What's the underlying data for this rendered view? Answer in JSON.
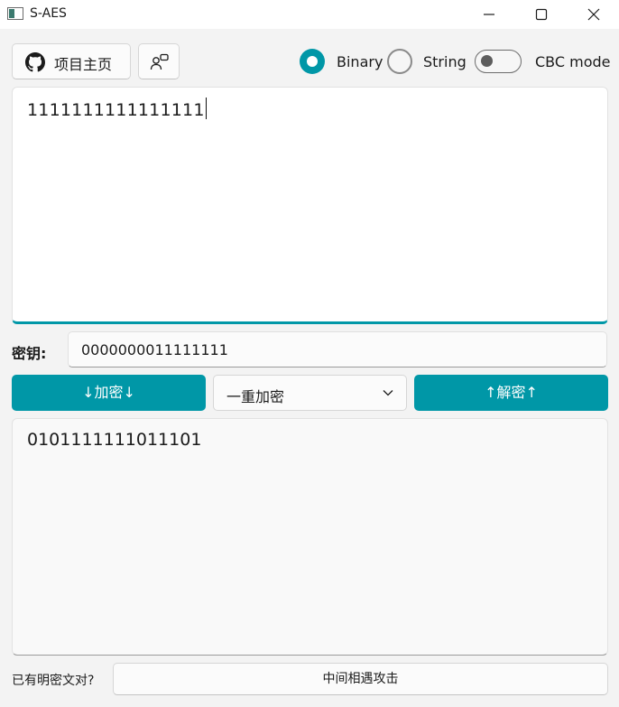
{
  "window": {
    "title": "S-AES"
  },
  "toolbar": {
    "home_label": "项目主页",
    "home_icon": "github-icon",
    "users_icon": "users-icon",
    "format_options": [
      {
        "label": "Binary",
        "selected": true
      },
      {
        "label": "String",
        "selected": false
      }
    ],
    "cbc_label": "CBC mode",
    "cbc_enabled": false
  },
  "plaintext": {
    "value": "1111111111111111"
  },
  "key": {
    "label": "密钥:",
    "value": "0000000011111111"
  },
  "actions": {
    "encrypt_label": "↓加密↓",
    "mode_selected": "一重加密",
    "decrypt_label": "↑解密↑"
  },
  "output": {
    "value": "0101111111011101"
  },
  "footer": {
    "question": "已有明密文对?",
    "attack_label": "中间相遇攻击"
  },
  "colors": {
    "accent": "#0097a7"
  }
}
